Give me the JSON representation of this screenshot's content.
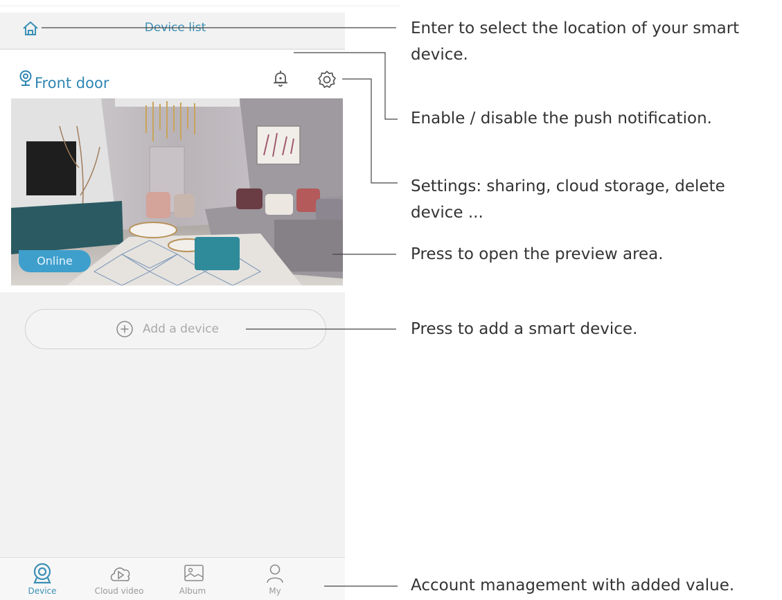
{
  "app": {
    "header": {
      "title": "Device list",
      "home_icon": "home-icon"
    },
    "device": {
      "name": "Front door",
      "status": "Online",
      "location_icon": "location-pin-icon",
      "notification_icon": "bell-icon",
      "settings_icon": "gear-icon"
    },
    "add_device": {
      "label": "Add a device",
      "icon": "plus-circle-icon"
    },
    "tabs": [
      {
        "label": "Device",
        "icon": "camera-icon",
        "active": true
      },
      {
        "label": "Cloud video",
        "icon": "cloud-play-icon",
        "active": false
      },
      {
        "label": "Album",
        "icon": "image-icon",
        "active": false
      },
      {
        "label": "My",
        "icon": "user-icon",
        "active": false
      }
    ],
    "colors": {
      "accent": "#3a8fb5",
      "badge": "#3f9fcc",
      "background": "#f2f2f2"
    }
  },
  "annotations": {
    "location": "Enter to select the location of your smart device.",
    "notification": "Enable / disable the push notification.",
    "settings": "Settings: sharing, cloud storage, delete device ...",
    "preview": "Press to open the preview area.",
    "add": "Press to add a smart device.",
    "account": "Account management with added value."
  }
}
